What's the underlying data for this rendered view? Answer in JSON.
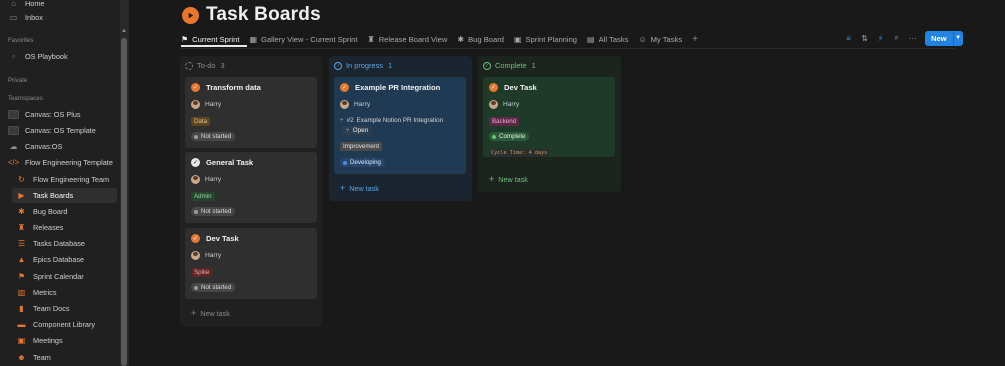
{
  "sidebar": {
    "top_items": [
      {
        "label": "Home",
        "icon": "home-icon"
      },
      {
        "label": "Inbox",
        "icon": "inbox-icon"
      }
    ],
    "favorites_label": "Favorites",
    "favorites": [
      {
        "label": "OS Playbook",
        "icon": "page-icon"
      }
    ],
    "private_label": "Private",
    "teamspaces_label": "Teamspaces",
    "teamspaces": [
      {
        "label": "Canvas: OS Plus",
        "icon": "canvas-icon"
      },
      {
        "label": "Canvas: OS Template",
        "icon": "canvas-icon"
      },
      {
        "label": "Canvas:OS",
        "icon": "cloud-icon"
      },
      {
        "label": "Flow Engineering Template",
        "icon": "code-icon"
      }
    ],
    "flow_items": [
      {
        "label": "Flow Engineering Team",
        "icon": "loop-icon"
      },
      {
        "label": "Task Boards",
        "icon": "play-circle-icon",
        "active": true
      },
      {
        "label": "Bug Board",
        "icon": "bug-icon"
      },
      {
        "label": "Releases",
        "icon": "release-icon"
      },
      {
        "label": "Tasks Database",
        "icon": "list-icon"
      },
      {
        "label": "Epics Database",
        "icon": "mountain-icon"
      },
      {
        "label": "Sprint Calendar",
        "icon": "runner-icon"
      },
      {
        "label": "Metrics",
        "icon": "chart-icon"
      },
      {
        "label": "Team Docs",
        "icon": "book-icon"
      },
      {
        "label": "Component Library",
        "icon": "folder-icon"
      },
      {
        "label": "Meetings",
        "icon": "calendar-icon"
      },
      {
        "label": "Team",
        "icon": "team-icon"
      }
    ]
  },
  "page": {
    "title": "Task Boards",
    "tabs": [
      {
        "label": "Current Sprint",
        "icon": "runner-icon",
        "active": true
      },
      {
        "label": "Gallery View - Current Sprint",
        "icon": "gallery-icon"
      },
      {
        "label": "Release Board View",
        "icon": "release-icon"
      },
      {
        "label": "Bug Board",
        "icon": "bug-icon"
      },
      {
        "label": "Sprint Planning",
        "icon": "calendar-icon"
      },
      {
        "label": "All Tasks",
        "icon": "table-icon"
      },
      {
        "label": "My Tasks",
        "icon": "person-icon"
      }
    ],
    "new_button": "New"
  },
  "board": {
    "columns": [
      {
        "name": "To-do",
        "count": "3",
        "new_task": "New task",
        "cards": [
          {
            "title": "Transform data",
            "assignee": "Harry",
            "tag": "Data",
            "status": "Not started"
          },
          {
            "title": "General Task",
            "assignee": "Harry",
            "tag": "Admin",
            "status": "Not started"
          },
          {
            "title": "Dev Task",
            "assignee": "Harry",
            "tag": "Spike",
            "status": "Not started"
          }
        ]
      },
      {
        "name": "In progress",
        "count": "1",
        "new_task": "New task",
        "cards": [
          {
            "title": "Example PR Integration",
            "assignee": "Harry",
            "pr_number": "#2",
            "pr_title": "Example Notion PR Integration",
            "pr_state": "Open",
            "tag": "Improvement",
            "status": "Developing"
          }
        ]
      },
      {
        "name": "Complete",
        "count": "1",
        "new_task": "New task",
        "cards": [
          {
            "title": "Dev Task",
            "assignee": "Harry",
            "tag": "Backend",
            "status": "Complete",
            "cycle_time": "Cycle Time: 4 days"
          }
        ]
      }
    ]
  },
  "colors": {
    "accent": "#2383e2",
    "orange": "#e8772e",
    "in_progress": "#5aa4e8",
    "complete": "#6cc07e"
  }
}
